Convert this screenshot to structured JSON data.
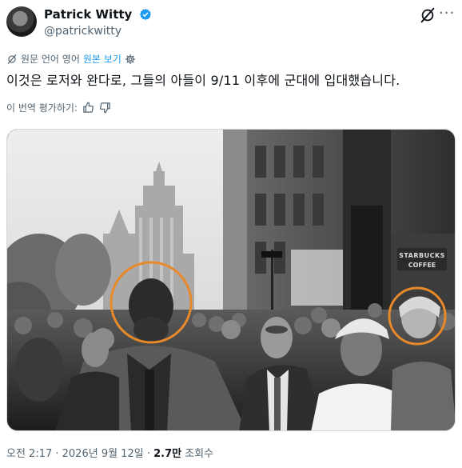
{
  "author": {
    "name": "Patrick Witty",
    "handle": "@patrickwitty"
  },
  "translation_bar": {
    "original_language": "원문 언어 영어",
    "show_original": "원본 보기"
  },
  "tweet_text": "이것은 로저와 완다로, 그들의 아들이 9/11 이후에 군대에 입대했습니다.",
  "rate_translation": "이 번역 평가하기:",
  "footer": {
    "time": "오전 2:17 · 2026년 9월 12일 · ",
    "views_count": "2.7만",
    "views_label": " 조회수"
  },
  "photo_sign": "STARBUCKS COFFEE",
  "colors": {
    "verified": "#1d9bf0",
    "link": "#1d9bf0",
    "highlight_circle": "#e8892a"
  }
}
